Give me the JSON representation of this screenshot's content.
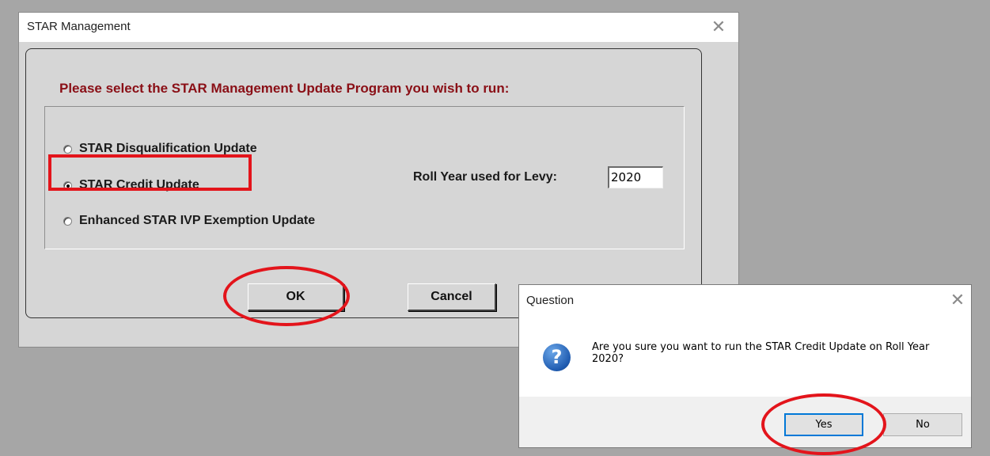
{
  "main_window": {
    "title": "STAR Management",
    "close_glyph": "✕",
    "prompt": "Please select the STAR Management Update Program you wish to run:",
    "options": [
      {
        "label": "STAR Disqualification Update",
        "selected": false
      },
      {
        "label": "STAR Credit Update",
        "selected": true
      },
      {
        "label": "Enhanced STAR IVP Exemption Update",
        "selected": false
      }
    ],
    "roll_year_label": "Roll Year used for Levy:",
    "roll_year_value": "2020",
    "ok_label": "OK",
    "cancel_label": "Cancel"
  },
  "question_dialog": {
    "title": "Question",
    "close_glyph": "✕",
    "icon": "question-icon",
    "icon_glyph": "?",
    "message": "Are you sure you want to run the STAR Credit Update on Roll Year 2020?",
    "yes_label": "Yes",
    "no_label": "No"
  },
  "colors": {
    "prompt": "#8a0f16",
    "annotation": "#e3141b",
    "dialog_background": "#d6d6d6",
    "desktop": "#a6a6a6"
  }
}
